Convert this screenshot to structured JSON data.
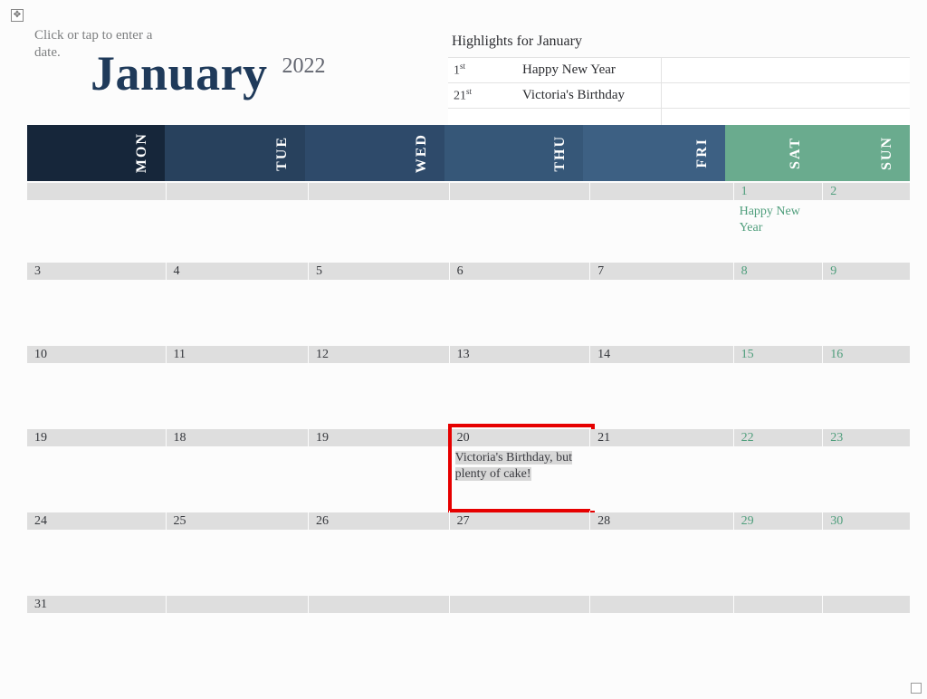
{
  "placeholder": "Click or tap to enter a date.",
  "month": "January",
  "year": "2022",
  "highlights_title": "Highlights for January",
  "highlights": [
    {
      "date_num": "1",
      "date_suf": "st",
      "event": "Happy New Year"
    },
    {
      "date_num": "21",
      "date_suf": "st",
      "event": "Victoria's Birthday"
    }
  ],
  "day_headers": [
    "MON",
    "TUE",
    "WED",
    "THU",
    "FRI",
    "SAT",
    "SUN"
  ],
  "weeks": [
    [
      {
        "n": ""
      },
      {
        "n": ""
      },
      {
        "n": ""
      },
      {
        "n": ""
      },
      {
        "n": ""
      },
      {
        "n": "1",
        "evt": "Happy New Year"
      },
      {
        "n": "2"
      }
    ],
    [
      {
        "n": "3"
      },
      {
        "n": "4"
      },
      {
        "n": "5"
      },
      {
        "n": "6"
      },
      {
        "n": "7"
      },
      {
        "n": "8"
      },
      {
        "n": "9"
      }
    ],
    [
      {
        "n": "10"
      },
      {
        "n": "11"
      },
      {
        "n": "12"
      },
      {
        "n": "13"
      },
      {
        "n": "14"
      },
      {
        "n": "15"
      },
      {
        "n": "16"
      }
    ],
    [
      {
        "n": "19"
      },
      {
        "n": "18"
      },
      {
        "n": "19"
      },
      {
        "n": "20",
        "evt": "Victoria's Birthday, but plenty of cake!",
        "selected": true
      },
      {
        "n": "21"
      },
      {
        "n": "22"
      },
      {
        "n": "23"
      }
    ],
    [
      {
        "n": "24"
      },
      {
        "n": "25"
      },
      {
        "n": "26"
      },
      {
        "n": "27"
      },
      {
        "n": "28"
      },
      {
        "n": "29"
      },
      {
        "n": "30"
      }
    ],
    [
      {
        "n": "31"
      },
      {
        "n": ""
      },
      {
        "n": ""
      },
      {
        "n": ""
      },
      {
        "n": ""
      },
      {
        "n": ""
      },
      {
        "n": ""
      }
    ]
  ]
}
